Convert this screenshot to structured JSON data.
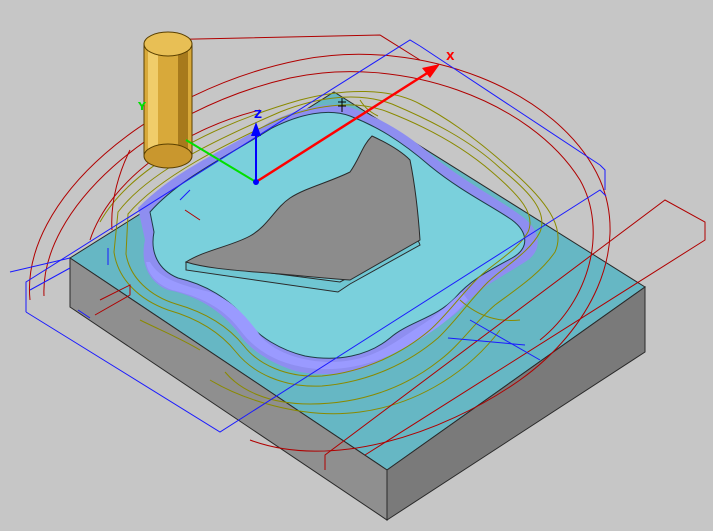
{
  "viewport": {
    "background": "#c6c6c6"
  },
  "axes": {
    "x_label": "X",
    "y_label": "Y",
    "z_label": "Z",
    "x_color": "#ff0000",
    "y_color": "#00e000",
    "z_color": "#0000ff"
  },
  "colors": {
    "stock_top": "#66b7c4",
    "stock_front": "#8f8f8f",
    "stock_right": "#7a7a7a",
    "pocket_floor": "#7ad0dc",
    "island_top": "#8c8c8c",
    "pocket_wall": "#8e8ef0",
    "tool": "#d8a93a",
    "toolpath_olive": "#8a8a00",
    "rapid_red": "#b00000",
    "boundary_blue": "#1a1aff"
  }
}
